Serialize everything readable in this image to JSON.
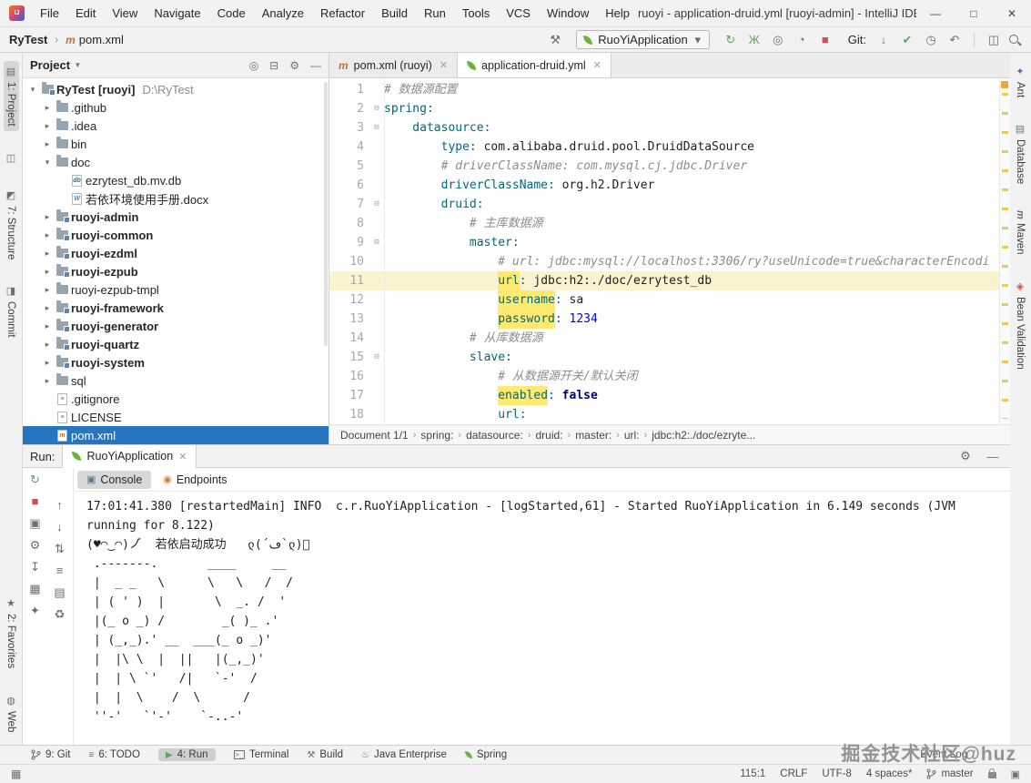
{
  "title_bar": {
    "logo": "IJ",
    "menus": [
      "File",
      "Edit",
      "View",
      "Navigate",
      "Code",
      "Analyze",
      "Refactor",
      "Build",
      "Run",
      "Tools",
      "VCS",
      "Window",
      "Help"
    ],
    "title": "ruoyi - application-druid.yml [ruoyi-admin] - IntelliJ IDEA",
    "window_controls": [
      "—",
      "□",
      "✕"
    ]
  },
  "navbar": {
    "project": "RyTest",
    "file": "pom.xml",
    "run_config": "RuoYiApplication",
    "git_label": "Git:"
  },
  "project": {
    "header": "Project",
    "items": [
      {
        "arrow": "▾",
        "label": "RyTest [ruoyi]",
        "suffix": "D:\\RyTest"
      },
      {
        "arrow": "▸",
        "label": ".github"
      },
      {
        "arrow": "▸",
        "label": ".idea"
      },
      {
        "arrow": "▸",
        "label": "bin"
      },
      {
        "arrow": "▾",
        "label": "doc"
      },
      {
        "arrow": "",
        "label": "ezrytest_db.mv.db"
      },
      {
        "arrow": "",
        "label": "若依环境使用手册.docx"
      },
      {
        "arrow": "▸",
        "label": "ruoyi-admin"
      },
      {
        "arrow": "▸",
        "label": "ruoyi-common"
      },
      {
        "arrow": "▸",
        "label": "ruoyi-ezdml"
      },
      {
        "arrow": "▸",
        "label": "ruoyi-ezpub"
      },
      {
        "arrow": "▸",
        "label": "ruoyi-ezpub-tmpl"
      },
      {
        "arrow": "▸",
        "label": "ruoyi-framework"
      },
      {
        "arrow": "▸",
        "label": "ruoyi-generator"
      },
      {
        "arrow": "▸",
        "label": "ruoyi-quartz"
      },
      {
        "arrow": "▸",
        "label": "ruoyi-system"
      },
      {
        "arrow": "▸",
        "label": "sql"
      },
      {
        "arrow": "",
        "label": ".gitignore"
      },
      {
        "arrow": "",
        "label": "LICENSE"
      },
      {
        "arrow": "",
        "label": "pom.xml"
      }
    ]
  },
  "tabs": [
    {
      "label": "pom.xml (ruoyi)"
    },
    {
      "label": "application-druid.yml"
    }
  ],
  "editor": {
    "lines": [
      {
        "n": "1",
        "c": "# 数据源配置"
      },
      {
        "n": "2",
        "fold": "⊟",
        "k": "spring:"
      },
      {
        "n": "3",
        "fold": "⊟",
        "k": "    datasource:"
      },
      {
        "n": "4",
        "k": "        type:",
        "v": " com.alibaba.druid.pool.DruidDataSource"
      },
      {
        "n": "5",
        "c": "        # driverClassName: com.mysql.cj.jdbc.Driver"
      },
      {
        "n": "6",
        "k": "        driverClassName:",
        "v": " org.h2.Driver"
      },
      {
        "n": "7",
        "fold": "⊟",
        "k": "        druid:"
      },
      {
        "n": "8",
        "c": "            # 主库数据源"
      },
      {
        "n": "9",
        "fold": "⊟",
        "k": "            master:"
      },
      {
        "n": "10",
        "c": "                # url: jdbc:mysql://localhost:3306/ry?useUnicode=true&characterEncodi"
      },
      {
        "n": "11",
        "sp": "                ",
        "hl": "url",
        "k": ":",
        "v": " jdbc:h2:./doc/ezrytest_db"
      },
      {
        "n": "12",
        "sp": "                ",
        "hl": "username",
        "k": ":",
        "v": " sa"
      },
      {
        "n": "13",
        "sp": "                ",
        "hl": "password",
        "k": ":",
        "num": " 1234"
      },
      {
        "n": "14",
        "c": "            # 从库数据源"
      },
      {
        "n": "15",
        "fold": "⊟",
        "k": "            slave:"
      },
      {
        "n": "16",
        "c": "                # 从数据源开关/默认关闭"
      },
      {
        "n": "17",
        "sp": "                ",
        "hl": "enabled",
        "k": ":",
        "kw": " false"
      },
      {
        "n": "18",
        "k": "                url:"
      }
    ]
  },
  "breadcrumbs": [
    "Document 1/1",
    "spring:",
    "datasource:",
    "druid:",
    "master:",
    "url:",
    "jdbc:h2:./doc/ezryte..."
  ],
  "run_panel": {
    "label": "Run:",
    "tab": "RuoYiApplication",
    "console_tab": "Console",
    "endpoints_tab": "Endpoints",
    "console_lines": [
      "17:01:41.380 [restartedMain] INFO  c.r.RuoYiApplication - [logStarted,61] - Started RuoYiApplication in 6.149 seconds (JVM",
      "running for 8.122)",
      "(♥◠‿◠)ノ゙  若依启动成功   ლ(´ڡ`ლ)゙",
      " .-------.       ____     __        ",
      " |  _ _   \\      \\   \\   /  /    ",
      " | ( ' )  |       \\  _. /  '       ",
      " |(_ o _) /        _( )_ .'         ",
      " | (_,_).' __  ___(_ o _)'  ",
      " |  |\\ \\  |  ||   |(_,_)'         ",
      " |  | \\ `'   /|   `-'  /           ",
      " |  |  \\    /  \\      /           ",
      " ''-'   `'-'    `-..-'              "
    ]
  },
  "toolwindow_bar": {
    "items": [
      "9: Git",
      "6: TODO",
      "4: Run",
      "Terminal",
      "Build",
      "Java Enterprise",
      "Spring"
    ],
    "event_log": "Event Log"
  },
  "status_bar": {
    "caret": "115:1",
    "line_sep": "CRLF",
    "encoding": "UTF-8",
    "indent": "4 spaces*",
    "branch": "master"
  },
  "stripes": {
    "left_top": [
      "1: Project",
      "7: Structure",
      "Commit"
    ],
    "left_bottom": [
      "2: Favorites",
      "Web"
    ],
    "right": [
      "Ant",
      "Database",
      "Maven",
      "Bean Validation"
    ]
  },
  "watermark": "掘金技术社区@huz",
  "icons": {
    "hammer": "⚒",
    "gear": "⚙",
    "hide": "—",
    "rerun": "↻",
    "debug": "Ж",
    "coverage": "◎",
    "profiler": "◔",
    "stop": "■",
    "update": "↓",
    "commit_check": "✔",
    "history": "◷",
    "rollback": "↶",
    "layout": "◫",
    "chevron_down": "▾",
    "chevron_sep": "›",
    "close": "✕",
    "locate": "◎",
    "collapse_all": "⊟",
    "console": "▣",
    "endpoints": "◉",
    "scroll_up": "↑",
    "scroll_down": "↓",
    "swap": "⇅",
    "softwrap": "≡",
    "print": "▤",
    "clear": "♻",
    "screenshot": "▣",
    "import": "↧",
    "grid": "▦",
    "pin": "✦",
    "todo": "≡",
    "run_play": "▶",
    "java_ee": "♨",
    "switcher": "▦",
    "maven_m": "m",
    "file_db": "db",
    "file_docx": "W",
    "file_git": "≡",
    "file_txt": "≡",
    "stripe_project": "▤",
    "stripe_pin": "◫",
    "stripe_structure": "◩",
    "stripe_commit": "◨",
    "stripe_fav": "★",
    "stripe_web": "◍",
    "stripe_ant": "✦",
    "stripe_db": "▤",
    "stripe_bean": "◈"
  },
  "colors": {
    "selection": "#2675BF",
    "highlight": "#FFE96E",
    "caret_line": "#FBF2CF",
    "spring_green": "#6DB33F",
    "run_green": "#59A869",
    "stop_red": "#C75450",
    "stripe_yellow": "#F5C944"
  }
}
